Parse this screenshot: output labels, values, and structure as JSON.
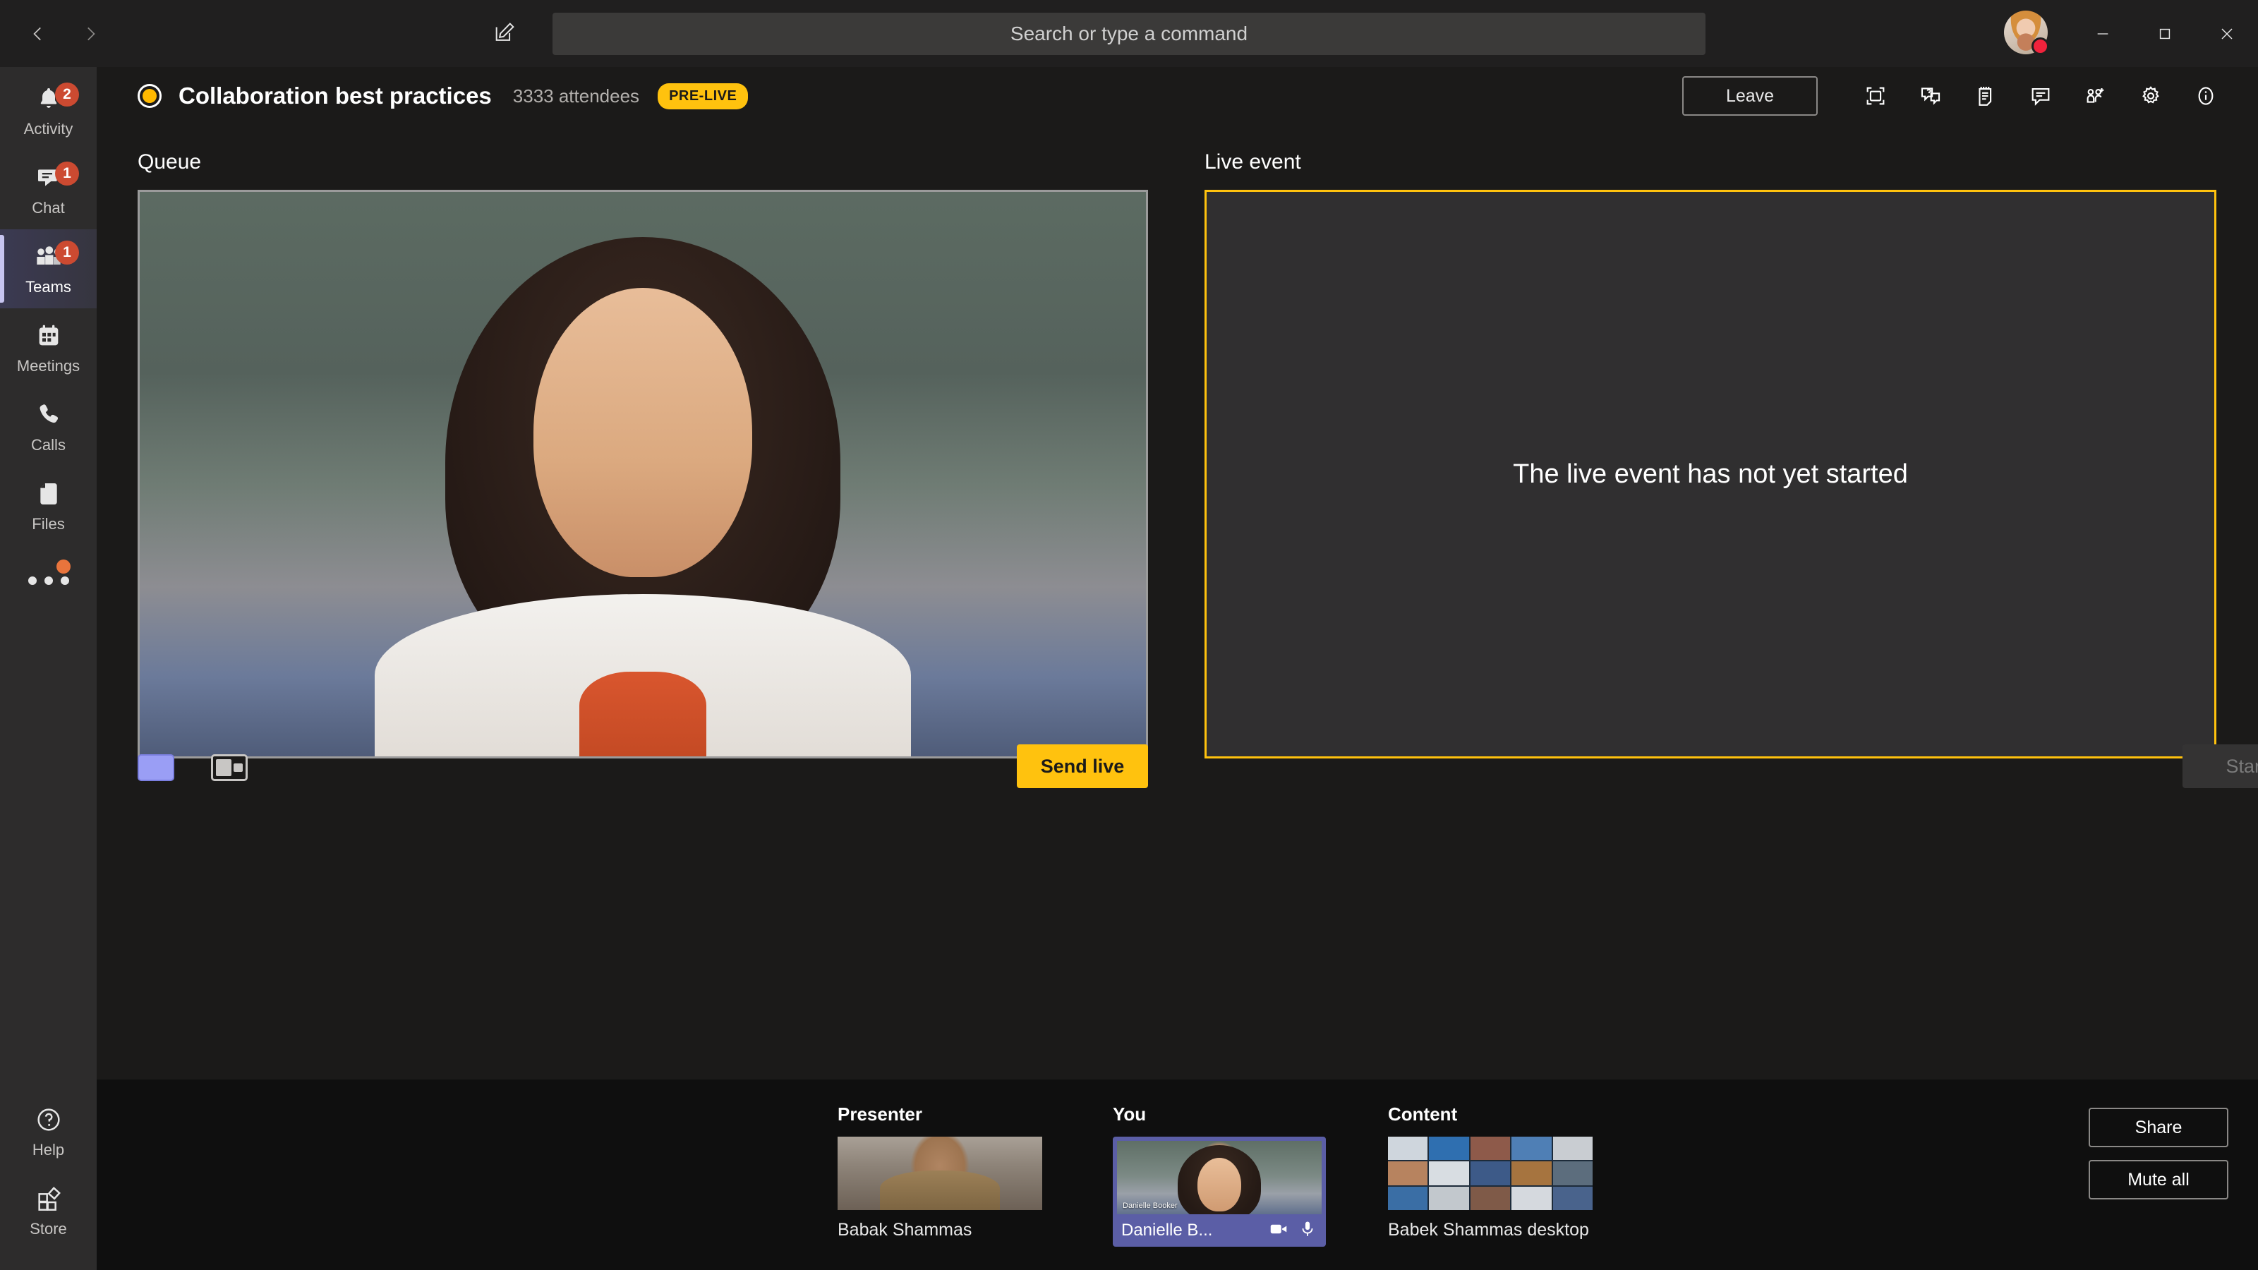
{
  "titlebar": {
    "back_icon": "chevron-left-icon",
    "forward_icon": "chevron-right-icon",
    "compose_icon": "compose-pencil-icon",
    "search_placeholder": "Search or type a command",
    "avatar_name": "user-avatar",
    "presence": "busy",
    "minimize_label": "—",
    "maximize_label": "□",
    "close_label": "✕"
  },
  "rail": {
    "items": [
      {
        "label": "Activity",
        "icon": "bell-icon",
        "badge": "2",
        "active": false
      },
      {
        "label": "Chat",
        "icon": "chat-bubble-icon",
        "badge": "1",
        "active": false
      },
      {
        "label": "Teams",
        "icon": "teams-people-icon",
        "badge": "1",
        "active": true
      },
      {
        "label": "Meetings",
        "icon": "calendar-icon",
        "badge": "",
        "active": false
      },
      {
        "label": "Calls",
        "icon": "phone-icon",
        "badge": "",
        "active": false
      },
      {
        "label": "Files",
        "icon": "file-icon",
        "badge": "",
        "active": false
      }
    ],
    "more_icon": "more-dots-icon",
    "bottom_items": [
      {
        "label": "Help",
        "icon": "help-circle-icon"
      },
      {
        "label": "Store",
        "icon": "store-icon"
      }
    ]
  },
  "event": {
    "status_icon": "recording-dot-icon",
    "title": "Collaboration best practices",
    "attendees": "3333 attendees",
    "badge": "PRE-LIVE",
    "leave_label": "Leave",
    "actions": [
      {
        "name": "full-screen-icon",
        "title": "Full screen"
      },
      {
        "name": "qna-icon",
        "title": "Q&A"
      },
      {
        "name": "notes-icon",
        "title": "Meeting notes"
      },
      {
        "name": "chat-icon",
        "title": "Chat"
      },
      {
        "name": "add-participant-icon",
        "title": "Add participant"
      },
      {
        "name": "settings-gear-icon",
        "title": "Settings"
      },
      {
        "name": "info-icon",
        "title": "Info"
      }
    ]
  },
  "stage": {
    "queue_title": "Queue",
    "live_title": "Live event",
    "live_message": "The live event has not yet started",
    "send_live_label": "Send live",
    "start_label": "Start",
    "layout_solid_name": "layout-single-option",
    "layout_pip_name": "layout-picture-in-picture-option",
    "queue_video_caption": ""
  },
  "tray": {
    "groups": [
      {
        "label": "Presenter",
        "name": "Babak Shammas",
        "thumb_caption": "",
        "selected": false
      },
      {
        "label": "You",
        "name": "Danielle B...",
        "thumb_caption": "Danielle Booker",
        "selected": true
      },
      {
        "label": "Content",
        "name": "Babek Shammas desktop",
        "thumb_caption": "",
        "selected": false
      }
    ],
    "camera_icon": "camera-icon",
    "mic_icon": "microphone-icon",
    "share_label": "Share",
    "mute_all_label": "Mute all"
  },
  "colors": {
    "accent_yellow": "#ffc20e",
    "selected_purple": "#5b5ea6",
    "badge_orange": "#cc4a31",
    "presence_red": "#f1233c"
  }
}
